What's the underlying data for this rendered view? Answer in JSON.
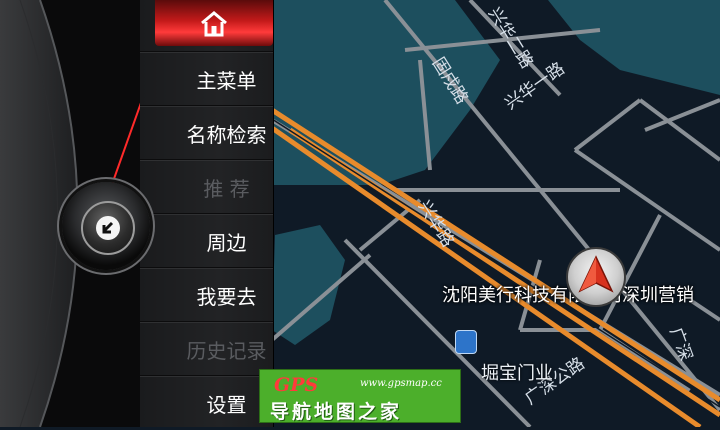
{
  "menu": {
    "home_icon": "home-icon",
    "items": [
      {
        "label": "主菜单",
        "enabled": true
      },
      {
        "label": "名称检索",
        "enabled": true
      },
      {
        "label": "推 荐",
        "enabled": false
      },
      {
        "label": "周边",
        "enabled": true
      },
      {
        "label": "我要去",
        "enabled": true
      },
      {
        "label": "历史记录",
        "enabled": false
      },
      {
        "label": "设置",
        "enabled": true
      }
    ]
  },
  "knob": {
    "icon": "back-arrow-icon"
  },
  "map": {
    "poi_label": "沈阳美行科技有限公司深圳营销",
    "poi_name": "堀宝门业",
    "road_labels": [
      "兴华二路",
      "兴华一路",
      "兴华路",
      "固戍路",
      "广深公路",
      "广深"
    ],
    "colors": {
      "water": "#1d4f5e",
      "road": "#8a9096",
      "highway": "#e88b2c",
      "ground": "#0f1a26"
    }
  },
  "watermark": {
    "brand": "GPS",
    "url": "www.gpsmap.cc",
    "text": "导航地图之家"
  },
  "colors": {
    "accent": "#d81e1e",
    "disabled_text": "#5a5c60"
  }
}
